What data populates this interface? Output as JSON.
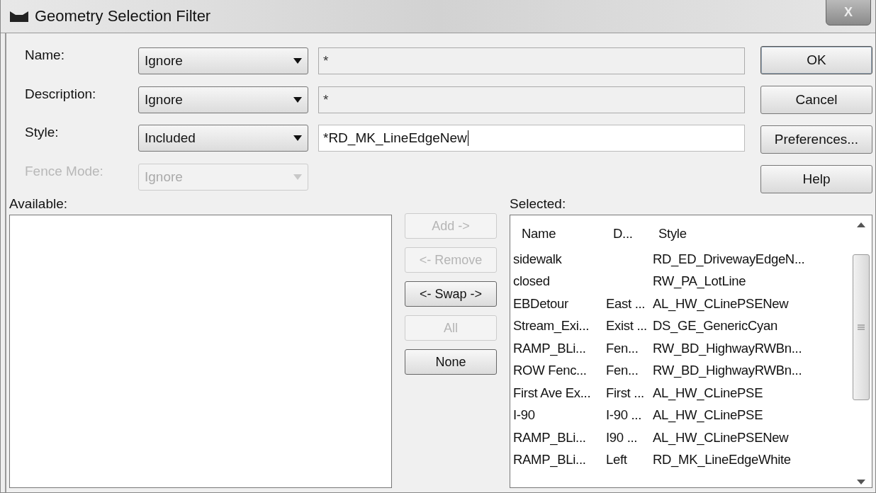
{
  "window": {
    "title": "Geometry Selection Filter",
    "close": "X"
  },
  "filters": [
    {
      "label": "Name:",
      "option": "Ignore",
      "value": "*",
      "disabled": false,
      "field_disabled": true
    },
    {
      "label": "Description:",
      "option": "Ignore",
      "value": "*",
      "disabled": false,
      "field_disabled": true
    },
    {
      "label": "Style:",
      "option": "Included",
      "value": "*RD_MK_LineEdgeNew",
      "disabled": false,
      "field_disabled": false
    },
    {
      "label": "Fence Mode:",
      "option": "Ignore",
      "disabled": true
    }
  ],
  "buttons": [
    {
      "label": "OK",
      "default": true
    },
    {
      "label": "Cancel",
      "default": false
    },
    {
      "label": "Preferences...",
      "default": false
    },
    {
      "label": "Help",
      "default": false
    }
  ],
  "available": {
    "label": "Available:"
  },
  "transfer_buttons": [
    {
      "label": "Add ->",
      "disabled": true
    },
    {
      "label": "<- Remove",
      "disabled": true
    },
    {
      "label": "<- Swap ->",
      "disabled": false
    },
    {
      "label": "All",
      "disabled": true
    },
    {
      "label": "None",
      "disabled": false
    }
  ],
  "selected": {
    "label": "Selected:",
    "columns": [
      "Name",
      "D...",
      "Style"
    ],
    "rows": [
      [
        "sidewalk",
        "",
        "RD_ED_DrivewayEdgeN..."
      ],
      [
        "closed",
        "",
        "RW_PA_LotLine"
      ],
      [
        "EBDetour",
        "East ...",
        "AL_HW_CLinePSENew"
      ],
      [
        "Stream_Exi...",
        "Exist ...",
        "DS_GE_GenericCyan"
      ],
      [
        "RAMP_BLi...",
        "Fen...",
        "RW_BD_HighwayRWBn..."
      ],
      [
        "ROW Fenc...",
        "Fen...",
        "RW_BD_HighwayRWBn..."
      ],
      [
        "First Ave Ex...",
        "First ...",
        "AL_HW_CLinePSE"
      ],
      [
        "I-90",
        "I-90 ...",
        "AL_HW_CLinePSE"
      ],
      [
        "RAMP_BLi...",
        "I90 ...",
        "AL_HW_CLinePSENew"
      ],
      [
        "RAMP_BLi...",
        "Left",
        "RD_MK_LineEdgeWhite"
      ]
    ]
  }
}
